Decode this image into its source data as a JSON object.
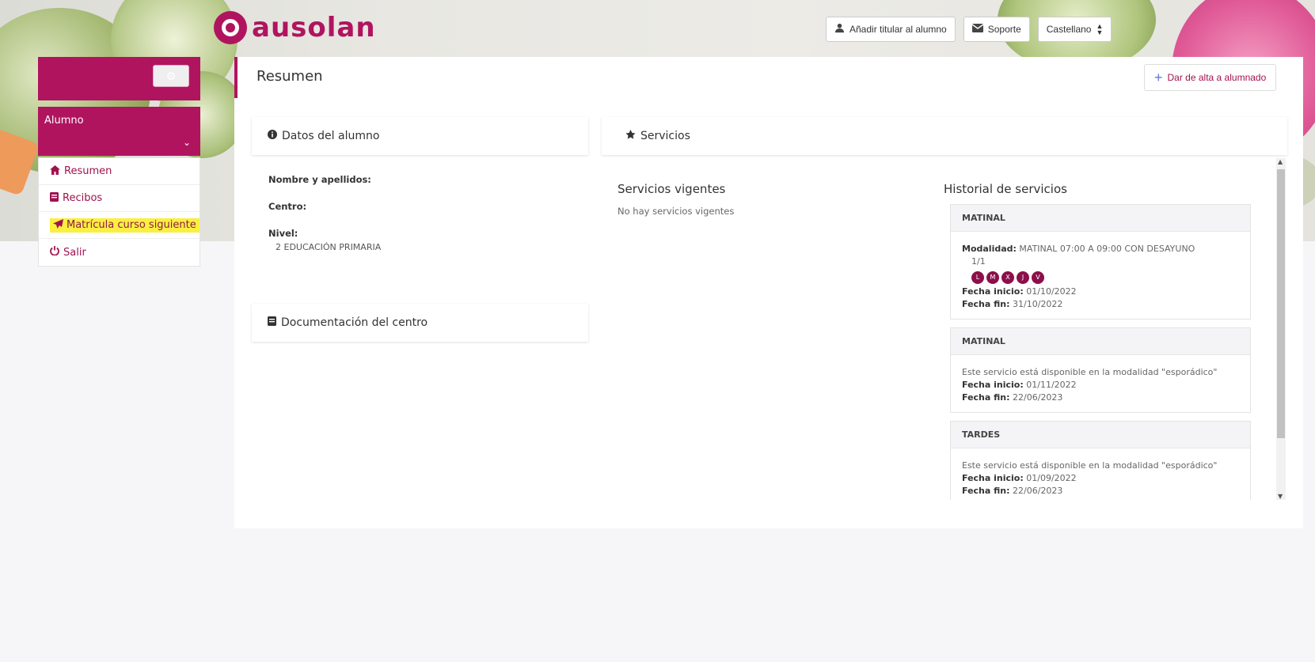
{
  "brand": {
    "name": "ausolan",
    "color": "#b0145f"
  },
  "header": {
    "add_holder_label": "Añadir titular al alumno",
    "support_label": "Soporte",
    "language_label": "Castellano"
  },
  "sidebar": {
    "settings_icon": "cogs-icon",
    "user_section": "Alumno",
    "items": [
      {
        "label": "Resumen",
        "icon": "home-icon"
      },
      {
        "label": "Recibos",
        "icon": "book-icon"
      },
      {
        "label": "Matrícula curso siguiente",
        "icon": "paper-plane-icon"
      },
      {
        "label": "Salir",
        "icon": "power-icon"
      }
    ]
  },
  "main": {
    "title": "Resumen",
    "add_student_label": "Dar de alta a alumnado",
    "student_card": {
      "title": "Datos del alumno",
      "name_label": "Nombre y apellidos:",
      "center_label": "Centro:",
      "level_label": "Nivel:",
      "level_value": "2 EDUCACIÓN PRIMARIA"
    },
    "docs_card": {
      "title": "Documentación del centro"
    },
    "services_card": {
      "title": "Servicios",
      "current_title": "Servicios vigentes",
      "current_empty": "No hay servicios vigentes",
      "history_title": "Historial de servicios",
      "history": [
        {
          "name": "MATINAL",
          "modalidad_label": "Modalidad:",
          "modalidad_value": "MATINAL 07:00 A 09:00 CON DESAYUNO",
          "fraction": "1/1",
          "days": [
            "L",
            "M",
            "X",
            "J",
            "V"
          ],
          "start_label": "Fecha inicio:",
          "start_value": "01/10/2022",
          "end_label": "Fecha fin:",
          "end_value": "31/10/2022"
        },
        {
          "name": "MATINAL",
          "note": "Este servicio está disponible en la modalidad \"esporádico\"",
          "start_label": "Fecha inicio:",
          "start_value": "01/11/2022",
          "end_label": "Fecha fin:",
          "end_value": "22/06/2023"
        },
        {
          "name": "TARDES",
          "note": "Este servicio está disponible en la modalidad \"esporádico\"",
          "start_label": "Fecha inicio:",
          "start_value": "01/09/2022",
          "end_label": "Fecha fin:",
          "end_value": "22/06/2023"
        }
      ]
    }
  }
}
